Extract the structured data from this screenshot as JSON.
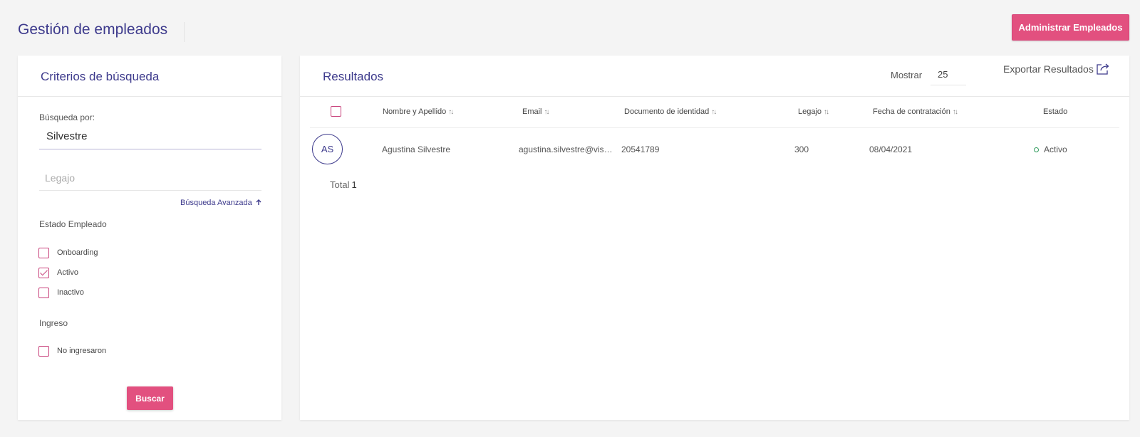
{
  "header": {
    "title": "Gestión de empleados",
    "admin_button": "Administrar Empleados"
  },
  "search": {
    "title": "Criterios de búsqueda",
    "search_label": "Búsqueda por:",
    "search_value": "Silvestre",
    "legajo_placeholder": "Legajo",
    "advanced_link": "Búsqueda Avanzada",
    "estado_label": "Estado Empleado",
    "estado_options": [
      {
        "label": "Onboarding",
        "checked": false
      },
      {
        "label": "Activo",
        "checked": true
      },
      {
        "label": "Inactivo",
        "checked": false
      }
    ],
    "ingreso_label": "Ingreso",
    "ingreso_options": [
      {
        "label": "No ingresaron",
        "checked": false
      }
    ],
    "buscar_button": "Buscar"
  },
  "results": {
    "title": "Resultados",
    "mostrar_label": "Mostrar",
    "page_size": "25",
    "export_label": "Exportar Resultados",
    "columns": [
      {
        "label": "Nombre y Apellido",
        "sortable": true
      },
      {
        "label": "Email",
        "sortable": true
      },
      {
        "label": "Documento de identidad",
        "sortable": true
      },
      {
        "label": "Legajo",
        "sortable": true
      },
      {
        "label": "Fecha de contratación",
        "sortable": true
      },
      {
        "label": "Estado",
        "sortable": false
      }
    ],
    "rows": [
      {
        "initials": "AS",
        "name": "Agustina Silvestre",
        "email": "agustina.silvestre@vism…",
        "document": "20541789",
        "legajo": "300",
        "hire_date": "08/04/2021",
        "status": "Activo"
      }
    ],
    "total_label": "Total",
    "total_count": "1"
  },
  "colors": {
    "accent": "#e2507f",
    "title": "#3d3a8c",
    "checkbox": "#c8407a",
    "status_active": "#2f9a5c"
  }
}
